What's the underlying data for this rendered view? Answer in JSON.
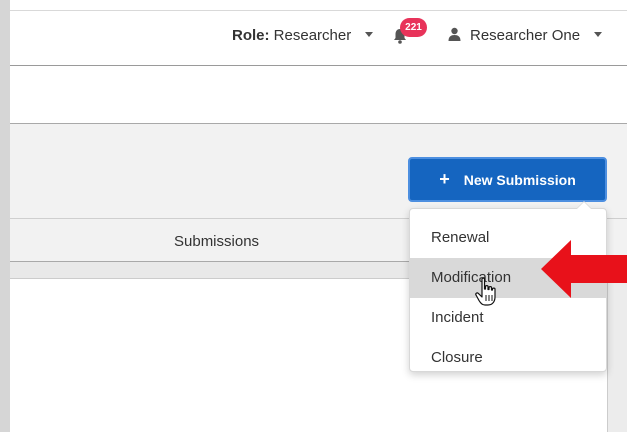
{
  "header": {
    "role_label": "Role:",
    "role_value": "Researcher",
    "notification_count": "221",
    "user_name": "Researcher One"
  },
  "actions": {
    "new_submission_label": "New Submission",
    "plus_icon": "+"
  },
  "tabs": {
    "submissions_label": "Submissions"
  },
  "dropdown": {
    "items": [
      {
        "label": "Renewal"
      },
      {
        "label": "Modification"
      },
      {
        "label": "Incident"
      },
      {
        "label": "Closure"
      }
    ],
    "highlighted": "Modification"
  },
  "icons": {
    "bell": "bell-icon",
    "user": "user-icon",
    "cursor": "hand-cursor-icon",
    "pointer": "red-arrow-icon"
  },
  "colors": {
    "primary_button": "#1565c0",
    "badge": "#e8335a",
    "highlight": "#d9d9d9",
    "annotation_arrow": "#e8111a"
  }
}
